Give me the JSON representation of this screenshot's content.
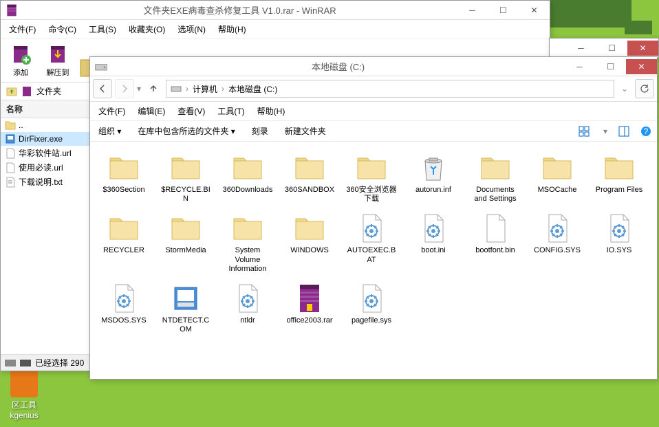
{
  "winrar": {
    "title": "文件夹EXE病毒查杀修复工具 V1.0.rar - WinRAR",
    "menu": [
      "文件(F)",
      "命令(C)",
      "工具(S)",
      "收藏夹(O)",
      "选项(N)",
      "帮助(H)"
    ],
    "tools": [
      {
        "label": "添加",
        "icon": "add"
      },
      {
        "label": "解压到",
        "icon": "extract"
      }
    ],
    "pathlabel": "文件夹",
    "listheader": "名称",
    "files": [
      {
        "name": "..",
        "icon": "folder-up"
      },
      {
        "name": "DirFixer.exe",
        "icon": "exe",
        "selected": true
      },
      {
        "name": "华彩软件站.url",
        "icon": "url"
      },
      {
        "name": "使用必读.url",
        "icon": "url"
      },
      {
        "name": "下载说明.txt",
        "icon": "txt"
      }
    ],
    "status": "已经选择 290"
  },
  "explorer": {
    "title": "本地磁盘 (C:)",
    "breadcrumbs": [
      "计算机",
      "本地磁盘 (C:)"
    ],
    "menu": [
      "文件(F)",
      "编辑(E)",
      "查看(V)",
      "工具(T)",
      "帮助(H)"
    ],
    "cmdbar": {
      "organize": "组织 ▾",
      "include": "在库中包含所选的文件夹 ▾",
      "burn": "刻录",
      "newfolder": "新建文件夹"
    },
    "items": [
      {
        "name": "$360Section",
        "type": "folder"
      },
      {
        "name": "$RECYCLE.BIN",
        "type": "folder"
      },
      {
        "name": "360Downloads",
        "type": "folder"
      },
      {
        "name": "360SANDBOX",
        "type": "folder"
      },
      {
        "name": "360安全浏览器下载",
        "type": "folder"
      },
      {
        "name": "autorun.inf",
        "type": "recycle"
      },
      {
        "name": "Documents and Settings",
        "type": "folder"
      },
      {
        "name": "MSOCache",
        "type": "folder"
      },
      {
        "name": "Program Files",
        "type": "folder"
      },
      {
        "name": "RECYCLER",
        "type": "folder"
      },
      {
        "name": "StormMedia",
        "type": "folder"
      },
      {
        "name": "System Volume Information",
        "type": "folder"
      },
      {
        "name": "WINDOWS",
        "type": "folder"
      },
      {
        "name": "AUTOEXEC.BAT",
        "type": "sysfile"
      },
      {
        "name": "boot.ini",
        "type": "sysfile"
      },
      {
        "name": "bootfont.bin",
        "type": "file"
      },
      {
        "name": "CONFIG.SYS",
        "type": "sysfile"
      },
      {
        "name": "IO.SYS",
        "type": "sysfile"
      },
      {
        "name": "MSDOS.SYS",
        "type": "sysfile"
      },
      {
        "name": "NTDETECT.COM",
        "type": "app"
      },
      {
        "name": "ntldr",
        "type": "sysfile"
      },
      {
        "name": "office2003.rar",
        "type": "rar"
      },
      {
        "name": "pagefile.sys",
        "type": "sysfile"
      }
    ]
  },
  "desktop": {
    "icon1": "区工具",
    "icon1b": "kgenius"
  }
}
